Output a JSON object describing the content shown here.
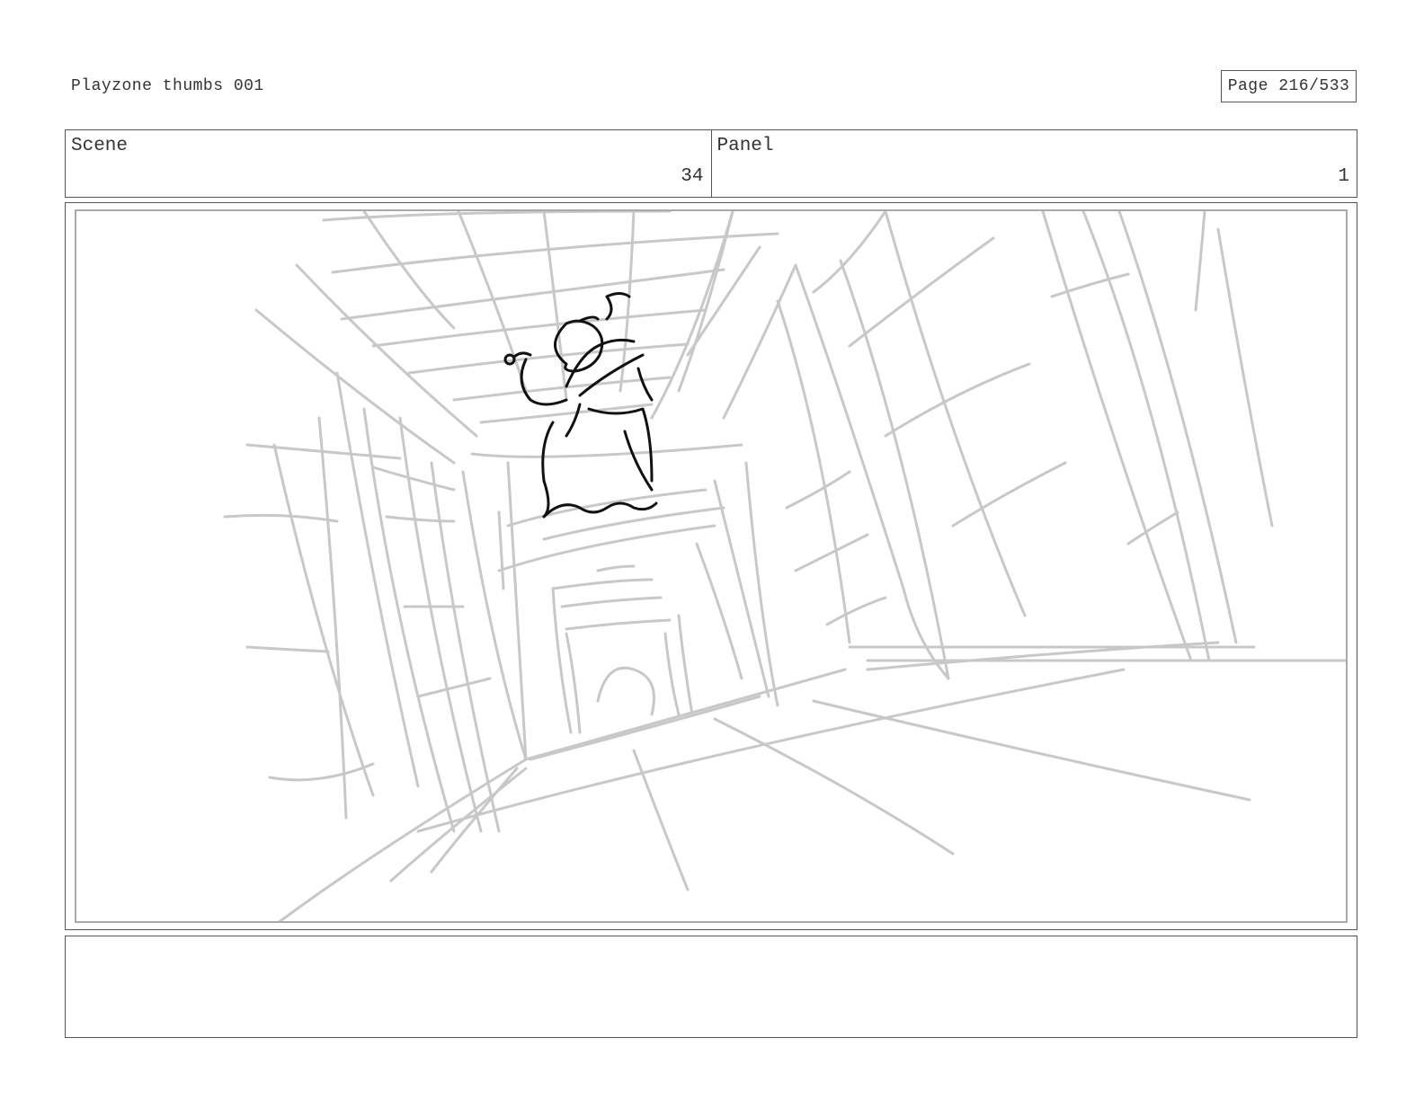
{
  "document": {
    "title": "Playzone thumbs 001",
    "page": "Page 216/533"
  },
  "header": {
    "scene_label": "Scene",
    "scene_value": "34",
    "panel_label": "Panel",
    "panel_value": "1"
  },
  "notes": {
    "text": ""
  },
  "colors": {
    "sketch_gray": "#c8c8c8",
    "sketch_ink": "#111111",
    "border": "#555555"
  }
}
